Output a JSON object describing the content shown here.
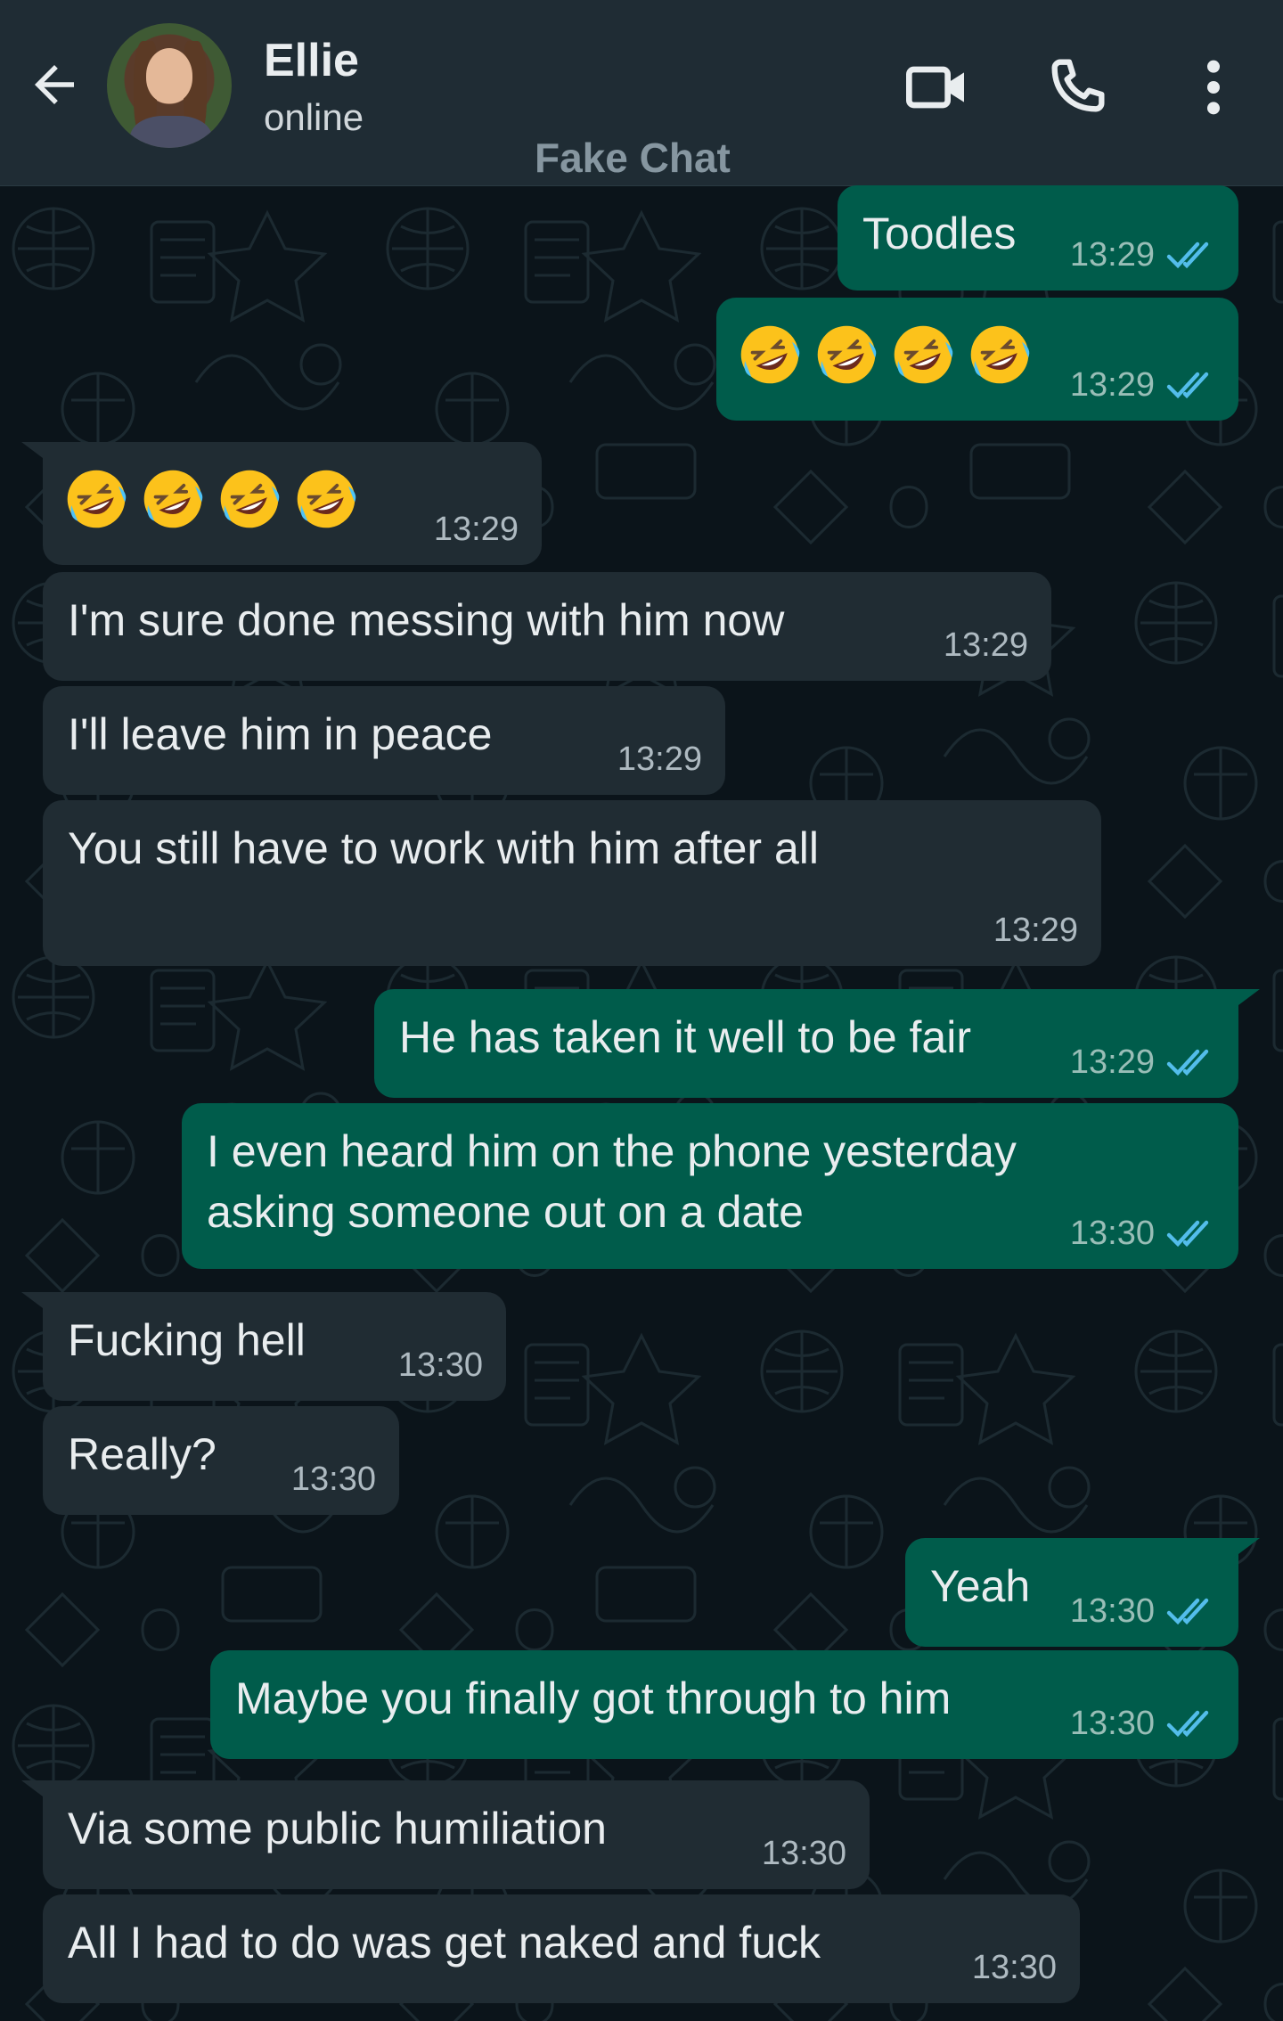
{
  "header": {
    "contact_name": "Ellie",
    "status": "online",
    "watermark": "Fake Chat",
    "icons": [
      "back-arrow-icon",
      "video-call-icon",
      "phone-icon",
      "more-vert-icon"
    ]
  },
  "colors": {
    "header_bg": "#1f2c34",
    "chat_bg": "#0b141a",
    "incoming_bubble": "#202c33",
    "outgoing_bubble": "#005c4b",
    "read_tick": "#53bdeb"
  },
  "messages": [
    {
      "dir": "out",
      "text": "Toodles",
      "time": "13:29",
      "read": true
    },
    {
      "dir": "out",
      "text": "🤣🤣🤣🤣",
      "emoji_count": 4,
      "time": "13:29",
      "read": true
    },
    {
      "dir": "in",
      "text": "🤣🤣🤣🤣",
      "emoji_count": 4,
      "time": "13:29"
    },
    {
      "dir": "in",
      "text": "I'm sure done messing with him now",
      "time": "13:29"
    },
    {
      "dir": "in",
      "text": "I'll leave him in peace",
      "time": "13:29"
    },
    {
      "dir": "in",
      "text": "You still have to work with him after all",
      "time": "13:29"
    },
    {
      "dir": "out",
      "text": "He has taken it well to be fair",
      "time": "13:29",
      "read": true
    },
    {
      "dir": "out",
      "text": "I even heard him on the phone yesterday\nasking someone out on a date",
      "time": "13:30",
      "read": true
    },
    {
      "dir": "in",
      "text": "Fucking hell",
      "time": "13:30"
    },
    {
      "dir": "in",
      "text": "Really?",
      "time": "13:30"
    },
    {
      "dir": "out",
      "text": "Yeah",
      "time": "13:30",
      "read": true
    },
    {
      "dir": "out",
      "text": "Maybe you finally got through to him",
      "time": "13:30",
      "read": true
    },
    {
      "dir": "in",
      "text": "Via some public humiliation",
      "time": "13:30"
    },
    {
      "dir": "in",
      "text": "All I had to do was get naked and fuck",
      "time": "13:30"
    }
  ]
}
